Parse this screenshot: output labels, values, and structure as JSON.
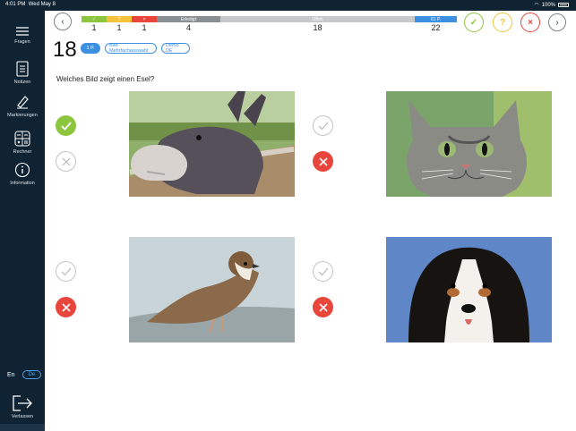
{
  "status": {
    "time": "4:01 PM",
    "day": "Wed May 8",
    "battery": "100%"
  },
  "sidebar": {
    "items": [
      {
        "label": "Fragen"
      },
      {
        "label": "Notizen"
      },
      {
        "label": "Markierungen"
      },
      {
        "label": "Rechner"
      },
      {
        "label": "Information"
      }
    ],
    "lang_en": "En",
    "lang_de": "De",
    "exit_label": "Verlassen"
  },
  "progress": {
    "correct": {
      "count": "1",
      "icon": "✓",
      "color": "#8cc63f"
    },
    "unsure": {
      "count": "1",
      "icon": "?",
      "color": "#f5c33b"
    },
    "wrong": {
      "count": "1",
      "icon": "×",
      "color": "#e8453c"
    },
    "done": {
      "label": "Erledigt",
      "count": "4",
      "color": "#8a8f93"
    },
    "open": {
      "label": "Offen",
      "count": "18",
      "color": "#c7c9cb"
    },
    "points": {
      "label": "61 P.",
      "count": "22",
      "color": "#3d8fe0"
    }
  },
  "question": {
    "number": "18",
    "points": "1 P.",
    "tag_type": "Bild-Mehrfachauswahl",
    "tag_demo": "Demo DE",
    "text": "Welches Bild zeigt einen Esel?"
  },
  "answers": [
    {
      "image": "donkey",
      "selected": "correct"
    },
    {
      "image": "cat",
      "selected": "wrong"
    },
    {
      "image": "sparrow",
      "selected": "wrong"
    },
    {
      "image": "dog",
      "selected": "wrong"
    }
  ]
}
